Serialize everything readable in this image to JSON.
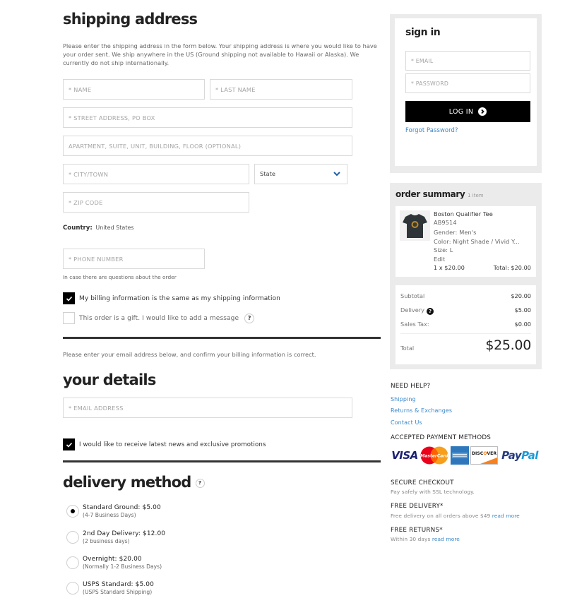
{
  "shipping": {
    "title": "shipping address",
    "intro": "Please enter the shipping address in the form below. Your shipping address is where you would like to have your order sent. We ship anywhere in the US (Ground shipping not available to Hawaii or Alaska). We currently do not ship internationally.",
    "fields": {
      "first_name": {
        "placeholder": "* NAME",
        "value": ""
      },
      "last_name": {
        "placeholder": "* LAST NAME",
        "value": ""
      },
      "street": {
        "placeholder": "* STREET ADDRESS, PO BOX",
        "value": ""
      },
      "apartment": {
        "placeholder": "APARTMENT, SUITE, UNIT, BUILDING, FLOOR (OPTIONAL)",
        "value": ""
      },
      "city": {
        "placeholder": "* CITY/TOWN",
        "value": ""
      },
      "state": {
        "selected": "State"
      },
      "zip": {
        "placeholder": "* ZIP CODE",
        "value": ""
      },
      "phone": {
        "placeholder": "* PHONE NUMBER",
        "value": ""
      }
    },
    "country_label": "Country:",
    "country_value": "United States",
    "phone_hint": "In case there are questions about the order",
    "billing_same": {
      "label": "My billing information is the same as my shipping information",
      "checked": true
    },
    "gift": {
      "label": "This order is a gift. I would like to add a message",
      "checked": false,
      "help_icon": "?"
    }
  },
  "details": {
    "intro": "Please enter your email address below, and confirm your billing information is correct.",
    "title": "your details",
    "email": {
      "placeholder": "* EMAIL ADDRESS",
      "value": ""
    },
    "newsletter": {
      "label": "I would like to receive latest news and exclusive promotions",
      "checked": true
    }
  },
  "delivery": {
    "title": "delivery method",
    "help_icon": "?",
    "options": [
      {
        "title": "Standard Ground: $5.00",
        "sub": "(4-7 Business Days)",
        "selected": true
      },
      {
        "title": "2nd Day Delivery: $12.00",
        "sub": "(2 business days)",
        "selected": false
      },
      {
        "title": "Overnight: $20.00",
        "sub": "(Normally 1-2 Business Days)",
        "selected": false
      },
      {
        "title": "USPS Standard: $5.00",
        "sub": "(USPS Standard Shipping)",
        "selected": false
      }
    ]
  },
  "signin": {
    "title": "sign in",
    "email_placeholder": "* EMAIL",
    "password_placeholder": "* PASSWORD",
    "login_label": "LOG IN",
    "forgot_label": "Forgot Password?"
  },
  "order_summary": {
    "title": "order summary",
    "count": "1 item",
    "item": {
      "name": "Boston Qualifier Tee",
      "sku": "AB9514",
      "gender": "Gender: Men's",
      "color": "Color: Night Shade / Vivid Y...",
      "size": "Size: L",
      "edit": "Edit",
      "qty_price": "1 x $20.00",
      "total": "Total: $20.00"
    },
    "subtotal_label": "Subtotal",
    "subtotal": "$20.00",
    "delivery_label": "Delivery",
    "delivery": "$5.00",
    "tax_label": "Sales Tax:",
    "tax": "$0.00",
    "total_label": "Total",
    "total": "$25.00"
  },
  "help": {
    "title": "NEED HELP?",
    "links": [
      "Shipping",
      "Returns & Exchanges",
      "Contact Us"
    ]
  },
  "payment": {
    "title": "ACCEPTED PAYMENT METHODS",
    "methods": [
      "VISA",
      "MasterCard",
      "American Express",
      "DISCOVER",
      "PayPal"
    ]
  },
  "info": [
    {
      "title": "SECURE CHECKOUT",
      "text": "Pay safely with SSL technology.",
      "link": ""
    },
    {
      "title": "FREE DELIVERY*",
      "text": "Free delivery on all orders above $49",
      "link": "read more"
    },
    {
      "title": "FREE RETURNS*",
      "text": "Within 30 days",
      "link": "read more"
    }
  ],
  "colors": {
    "accent_link": "#3a87c8",
    "button_bg": "#000000",
    "panel_bg": "#ebebeb"
  }
}
